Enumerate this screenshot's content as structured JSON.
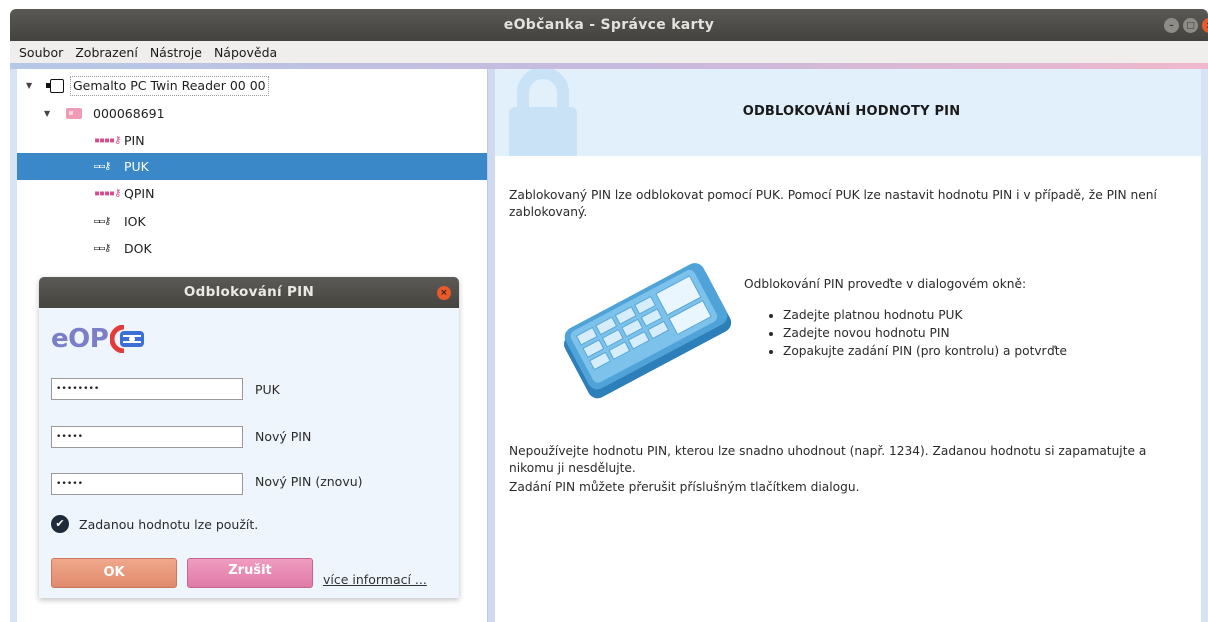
{
  "window": {
    "title": "eObčanka - Správce karty"
  },
  "menu": [
    "Soubor",
    "Zobrazení",
    "Nástroje",
    "Nápověda"
  ],
  "tree": {
    "reader": "Gemalto PC Twin Reader 00 00",
    "card": "000068691",
    "items": [
      "PIN",
      "PUK",
      "QPIN",
      "IOK",
      "DOK"
    ],
    "selected": "PUK"
  },
  "dialog": {
    "title": "Odblokování PIN",
    "logo_text": "eOP",
    "fields": [
      {
        "label": "PUK",
        "value": "••••••••"
      },
      {
        "label": "Nový PIN",
        "value": "•••••"
      },
      {
        "label": "Nový PIN (znovu)",
        "value": "•••••"
      }
    ],
    "status": "Zadanou hodnotu lze použít.",
    "ok_label": "OK",
    "cancel_label": "Zrušit",
    "more_link": "více informací ..."
  },
  "content": {
    "heading": "ODBLOKOVÁNÍ HODNOTY PIN",
    "intro": "Zablokovaný PIN lze odblokovat pomocí PUK. Pomocí PUK lze nastavit hodnotu PIN i v případě, že PIN není zablokovaný.",
    "instructions_title": "Odblokování PIN proveďte v dialogovém okně:",
    "steps": [
      "Zadejte platnou hodnotu PUK",
      "Zadejte novou hodnotu PIN",
      "Zopakujte zadání PIN (pro kontrolu) a potvrďte"
    ],
    "warning": "Nepoužívejte hodnotu PIN, kterou lze snadno uhodnout (např. 1234). Zadanou hodnotu si zapamatujte a nikomu ji nesdělujte.",
    "note": "Zadání PIN můžete přerušit příslušným tlačítkem dialogu."
  },
  "colors": {
    "selection": "#3a88c8",
    "banner": "#e1f0fb",
    "ok_button": "#e8967a",
    "cancel_button": "#e88ab4"
  },
  "icons": {
    "reader": "card-reader-icon",
    "card": "smart-card-icon",
    "key": "key-icon",
    "keypad": "keypad-illustration"
  }
}
